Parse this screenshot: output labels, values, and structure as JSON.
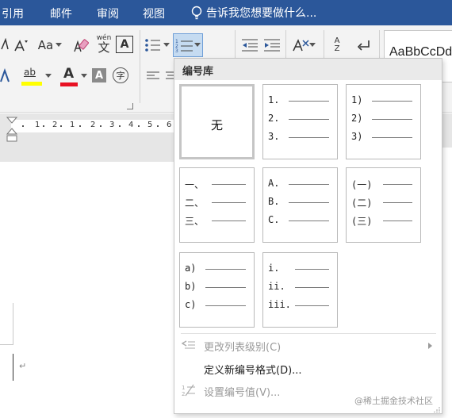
{
  "tabs": [
    "引用",
    "邮件",
    "审阅",
    "视图"
  ],
  "tell_me": "告诉我您想要做什么...",
  "ribbon": {
    "font_size_label": "Aa",
    "phonetic_label": "wén",
    "phonetic_char": "文",
    "char_border": "A",
    "highlight_label": "ab",
    "font_color_label": "A",
    "shading_label": "A",
    "enclose_char": "字",
    "sort_label_top": "A",
    "sort_label_bottom": "Z",
    "style_preview": "AaBbCcDd"
  },
  "ruler": {
    "numbers": [
      "1",
      "2",
      "1",
      "2",
      "3",
      "4",
      "5",
      "6"
    ]
  },
  "numbering_dropdown": {
    "header": "编号库",
    "none_label": "无",
    "formats": [
      {
        "name": "none",
        "labels": []
      },
      {
        "name": "decimal-period",
        "labels": [
          "1.",
          "2.",
          "3."
        ]
      },
      {
        "name": "decimal-paren",
        "labels": [
          "1)",
          "2)",
          "3)"
        ]
      },
      {
        "name": "chinese-comma",
        "labels": [
          "一、",
          "二、",
          "三、"
        ]
      },
      {
        "name": "upper-alpha-period",
        "labels": [
          "A.",
          "B.",
          "C."
        ]
      },
      {
        "name": "chinese-paren",
        "labels": [
          "(一)",
          "(二)",
          "(三)"
        ]
      },
      {
        "name": "lower-alpha-paren",
        "labels": [
          "a)",
          "b)",
          "c)"
        ]
      },
      {
        "name": "lower-roman-period",
        "labels": [
          "i.",
          "ii.",
          "iii."
        ]
      }
    ],
    "menu": {
      "change_level": "更改列表级别(C)",
      "define_format": "定义新编号格式(D)...",
      "set_value": "设置编号值(V)..."
    }
  },
  "watermark": "@稀土掘金技术社区",
  "paragraph_mark": "↵",
  "colors": {
    "ribbon_blue": "#2b579a",
    "font_red": "#e81123",
    "highlight_yellow": "#ffff00"
  }
}
